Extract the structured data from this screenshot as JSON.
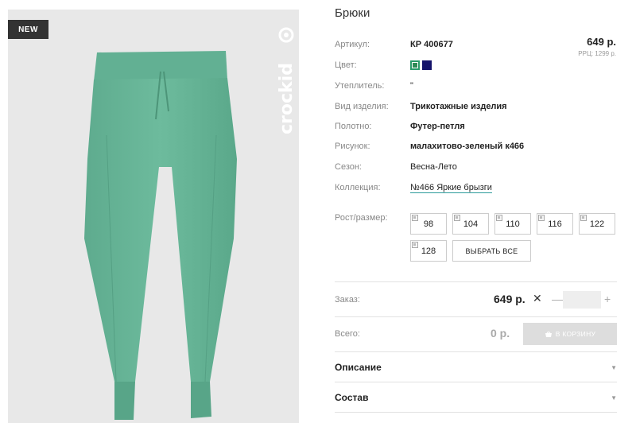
{
  "badge": "NEW",
  "brand": "crockid",
  "title": "Брюки",
  "price": "649 р.",
  "rrp": "РРЦ: 1299 р.",
  "details": {
    "article_label": "Артикул:",
    "article_value": "КР 400677",
    "color_label": "Цвет:",
    "insulation_label": "Утеплитель:",
    "insulation_value": "\"",
    "type_label": "Вид изделия:",
    "type_value": "Трикотажные изделия",
    "fabric_label": "Полотно:",
    "fabric_value": "Футер-петля",
    "pattern_label": "Рисунок:",
    "pattern_value": "малахитово-зеленый к466",
    "season_label": "Сезон:",
    "season_value": "Весна-Лето",
    "collection_label": "Коллекция:",
    "collection_value": "№466 Яркие брызги"
  },
  "colors": [
    "#2e8a55",
    "#14126a"
  ],
  "sizes": {
    "label": "Рост/размер:",
    "options": [
      "98",
      "104",
      "110",
      "116",
      "122",
      "128"
    ],
    "select_all": "ВЫБРАТЬ ВСЕ"
  },
  "order": {
    "label": "Заказ:",
    "price": "649 р.",
    "times": "✕",
    "minus": "—",
    "plus": "+",
    "qty": ""
  },
  "total": {
    "label": "Всего:",
    "value": "0 р.",
    "cart_button": "В КОРЗИНУ"
  },
  "accordion": {
    "description": "Описание",
    "composition": "Состав"
  }
}
